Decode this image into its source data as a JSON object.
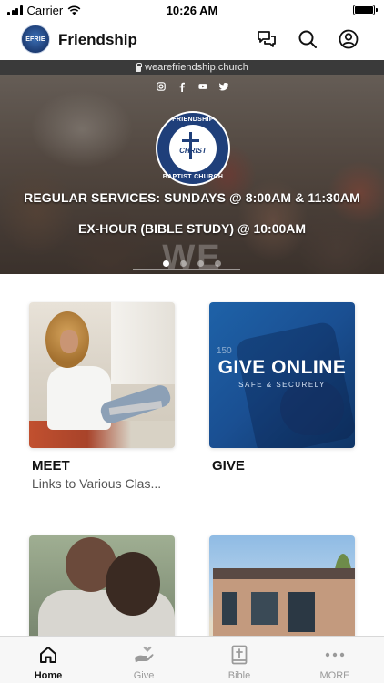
{
  "status_bar": {
    "carrier": "Carrier",
    "time": "10:26 AM",
    "battery_level": 1.0
  },
  "header": {
    "logo_text": "EFRIE",
    "title": "Friendship",
    "icons": [
      "chat-icon",
      "search-icon",
      "account-icon"
    ]
  },
  "url_bar": {
    "url": "wearefriendship.church"
  },
  "hero": {
    "socials": [
      "instagram-icon",
      "facebook-icon",
      "youtube-icon",
      "twitter-icon"
    ],
    "seal_top": "FRIENDSHIP",
    "seal_center": "CHRIST",
    "seal_bottom": "BAPTIST CHURCH",
    "line1": "REGULAR SERVICES: SUNDAYS @ 8:00AM & 11:30AM",
    "line2": "EX-HOUR (BIBLE STUDY) @ 10:00AM",
    "watermark": "WE",
    "slides": 4,
    "active_slide": 1
  },
  "tiles": [
    {
      "title": "MEET",
      "subtitle": "Links to Various Clas..."
    },
    {
      "title": "GIVE",
      "subtitle": "",
      "image_text": "GIVE ONLINE",
      "image_subtext": "SAFE & SECURELY",
      "image_number": "150"
    },
    {
      "title": "",
      "subtitle": ""
    },
    {
      "title": "",
      "subtitle": ""
    }
  ],
  "tabbar": {
    "items": [
      {
        "label": "Home",
        "icon": "home-icon",
        "active": true
      },
      {
        "label": "Give",
        "icon": "give-hands-icon",
        "active": false
      },
      {
        "label": "Bible",
        "icon": "bible-icon",
        "active": false
      },
      {
        "label": "MORE",
        "icon": "more-dots-icon",
        "active": false
      }
    ]
  },
  "colors": {
    "seal_blue": "#1f3f7a",
    "give_blue": "#1e62a8",
    "url_bar_bg": "#3a3a3a",
    "tab_active": "#111111",
    "tab_inactive": "#9a9a9a"
  }
}
